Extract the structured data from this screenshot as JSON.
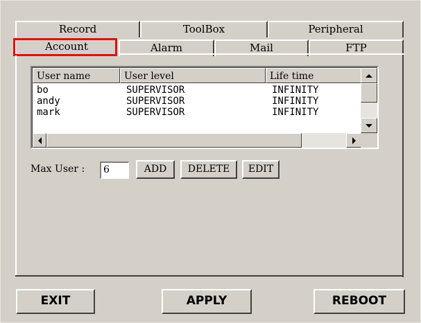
{
  "tabs_back": [
    {
      "label": "Record"
    },
    {
      "label": "ToolBox"
    },
    {
      "label": "Peripheral"
    }
  ],
  "tabs_front": [
    {
      "label": "Account",
      "active": true
    },
    {
      "label": "Alarm"
    },
    {
      "label": "Mail"
    },
    {
      "label": "FTP"
    }
  ],
  "list": {
    "columns": [
      "User name",
      "User level",
      "Life time"
    ],
    "rows": [
      [
        "bo",
        "SUPERVISOR",
        "INFINITY"
      ],
      [
        "andy",
        "SUPERVISOR",
        "INFINITY"
      ],
      [
        "mark",
        "SUPERVISOR",
        "INFINITY"
      ]
    ]
  },
  "max_user": {
    "label": "Max User :",
    "value": "6"
  },
  "actions": {
    "add": "ADD",
    "delete": "DELETE",
    "edit": "EDIT"
  },
  "footer": {
    "exit": "EXIT",
    "apply": "APPLY",
    "reboot": "REBOOT"
  },
  "colors": {
    "active_outline": "#e01010",
    "face": "#d4d0c8"
  }
}
